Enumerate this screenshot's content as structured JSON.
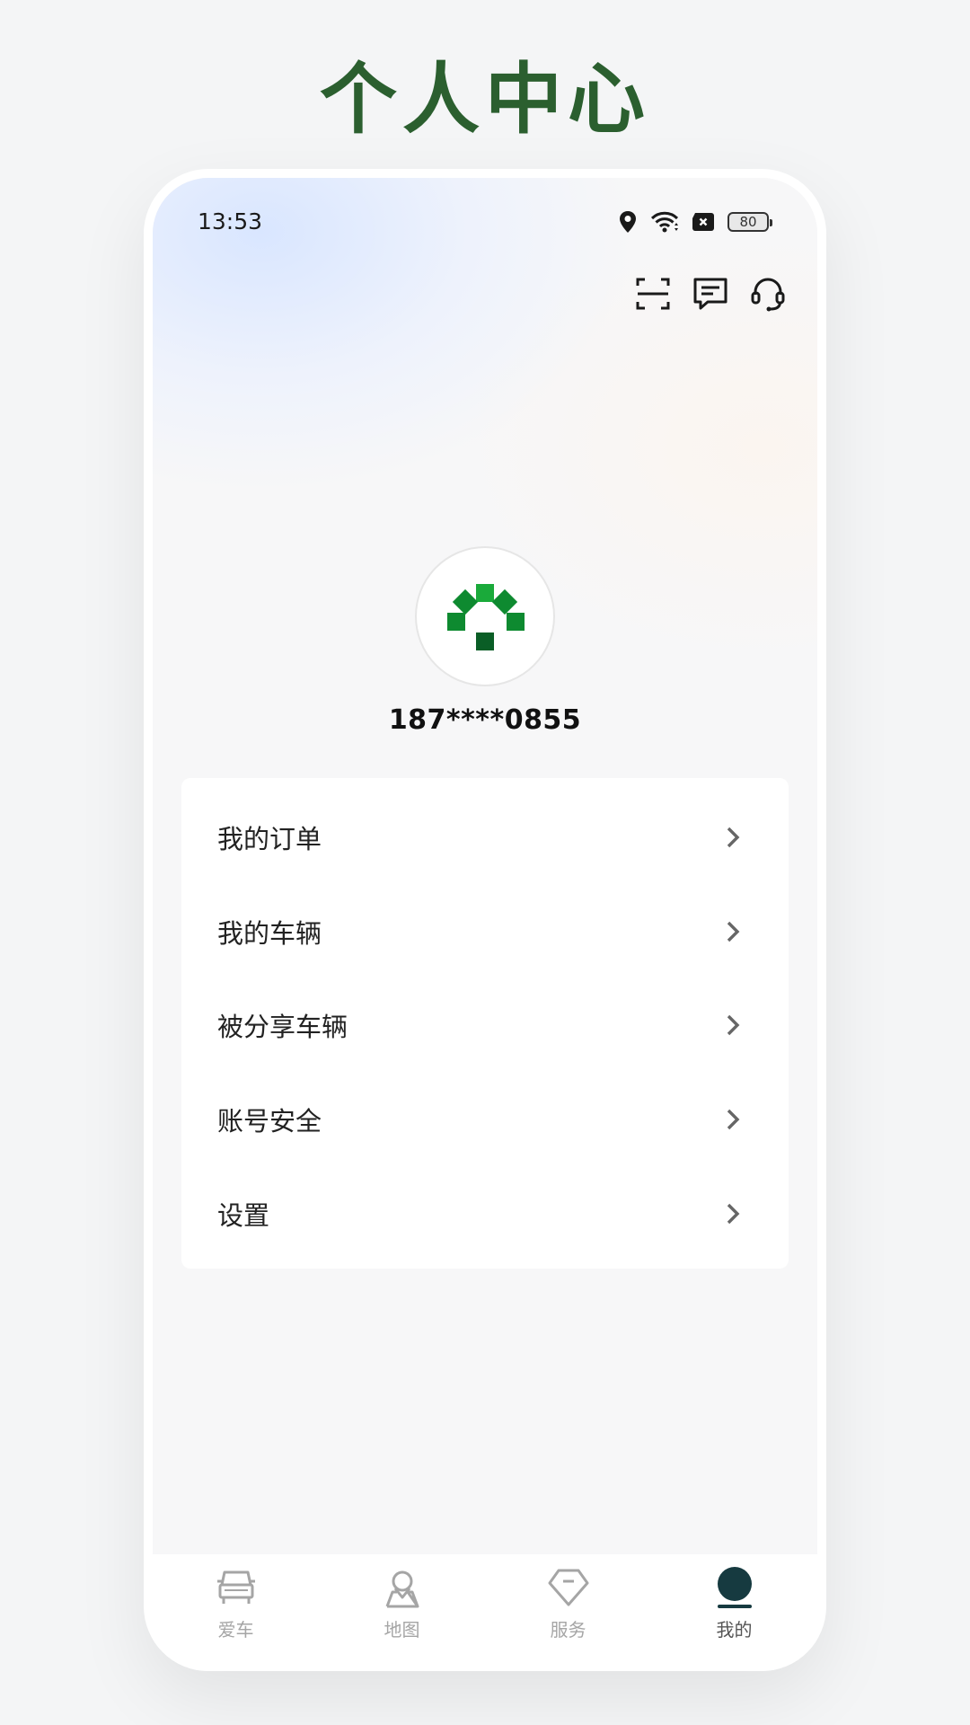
{
  "page": {
    "title": "个人中心"
  },
  "status_bar": {
    "time": "13:53",
    "battery": "80"
  },
  "top_actions": [
    {
      "name": "scan-icon"
    },
    {
      "name": "message-icon"
    },
    {
      "name": "customer-service-icon"
    }
  ],
  "profile": {
    "phone": "187****0855"
  },
  "menu": {
    "items": [
      {
        "label": "我的订单"
      },
      {
        "label": "我的车辆"
      },
      {
        "label": "被分享车辆"
      },
      {
        "label": "账号安全"
      },
      {
        "label": "设置"
      }
    ]
  },
  "tabbar": {
    "active_index": 3,
    "items": [
      {
        "label": "爱车",
        "icon": "car-icon"
      },
      {
        "label": "地图",
        "icon": "map-pin-icon"
      },
      {
        "label": "服务",
        "icon": "diamond-icon"
      },
      {
        "label": "我的",
        "icon": "user-icon"
      }
    ]
  },
  "colors": {
    "title_green": "#2b5f2f",
    "logo_green_light": "#1aaa3a",
    "logo_green_mid": "#0e8a30",
    "logo_green_dark": "#0a5e26",
    "tab_active": "#163a40",
    "tab_inactive": "#a5a5a5"
  }
}
